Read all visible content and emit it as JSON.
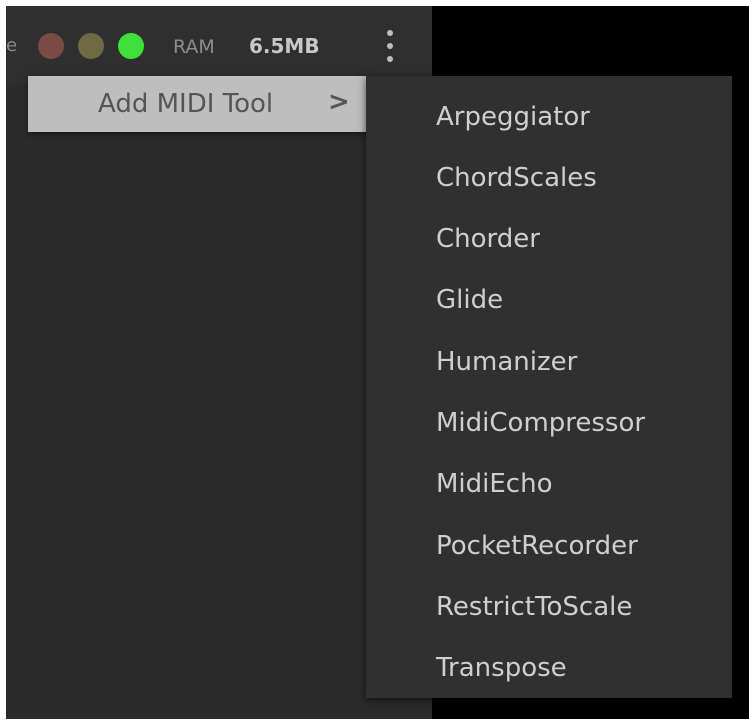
{
  "colors": {
    "red": "#7a4a44",
    "yellow": "#6e6a44",
    "green": "#3fe03a"
  },
  "topbar": {
    "edge_text": "e",
    "ram_label": "RAM",
    "ram_value": "6.5MB",
    "more_icon": "kebab-menu-icon"
  },
  "menu": {
    "add_midi_tool_label": "Add MIDI Tool",
    "chevron": ">"
  },
  "submenu": {
    "items": [
      {
        "label": "Arpeggiator"
      },
      {
        "label": "ChordScales"
      },
      {
        "label": "Chorder"
      },
      {
        "label": "Glide"
      },
      {
        "label": "Humanizer"
      },
      {
        "label": "MidiCompressor"
      },
      {
        "label": "MidiEcho"
      },
      {
        "label": "PocketRecorder"
      },
      {
        "label": "RestrictToScale"
      },
      {
        "label": "Transpose"
      }
    ]
  }
}
